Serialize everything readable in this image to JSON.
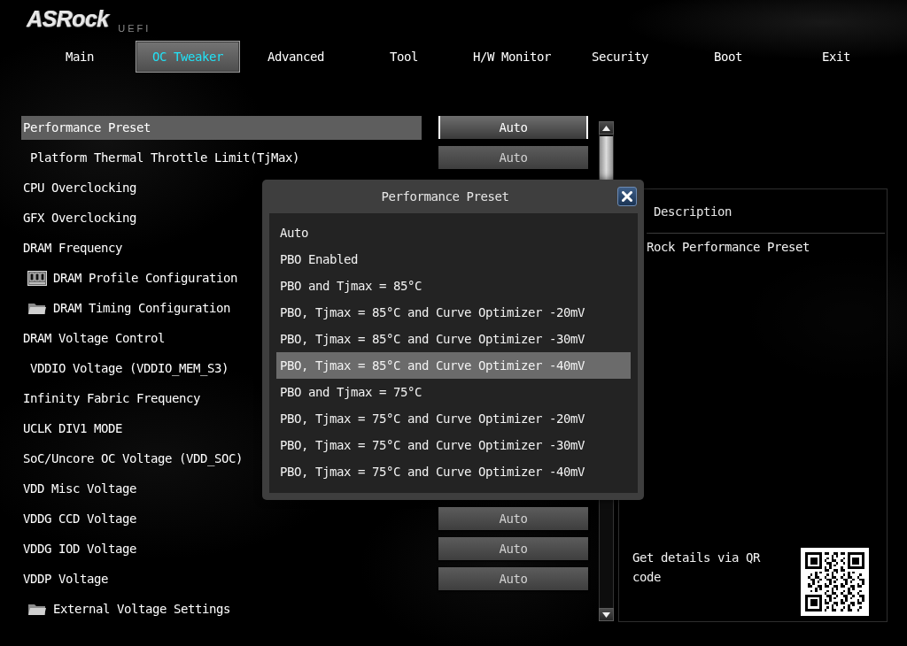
{
  "logo": {
    "brand": "ASRock",
    "suffix": "UEFI"
  },
  "tabs": [
    {
      "label": "Main",
      "selected": false
    },
    {
      "label": "OC Tweaker",
      "selected": true
    },
    {
      "label": "Advanced",
      "selected": false
    },
    {
      "label": "Tool",
      "selected": false
    },
    {
      "label": "H/W Monitor",
      "selected": false
    },
    {
      "label": "Security",
      "selected": false
    },
    {
      "label": "Boot",
      "selected": false
    },
    {
      "label": "Exit",
      "selected": false
    }
  ],
  "settings": {
    "rows": [
      {
        "kind": "item",
        "label": "Performance Preset",
        "selected": true,
        "value": "Auto"
      },
      {
        "kind": "subitem",
        "label": "Platform Thermal Throttle Limit(TjMax)",
        "selected": false,
        "value": "Auto"
      },
      {
        "kind": "item",
        "label": "CPU Overclocking",
        "selected": false
      },
      {
        "kind": "item",
        "label": "GFX Overclocking",
        "selected": false
      },
      {
        "kind": "item",
        "label": "DRAM Frequency",
        "selected": false
      },
      {
        "kind": "module",
        "label": "DRAM Profile Configuration",
        "selected": false
      },
      {
        "kind": "folder",
        "label": "DRAM Timing Configuration",
        "selected": false
      },
      {
        "kind": "item",
        "label": "DRAM Voltage Control",
        "selected": false
      },
      {
        "kind": "subitem",
        "label": "VDDIO Voltage (VDDIO_MEM_S3)",
        "selected": false
      },
      {
        "kind": "item",
        "label": "Infinity Fabric Frequency",
        "selected": false
      },
      {
        "kind": "item",
        "label": "UCLK DIV1 MODE",
        "selected": false
      },
      {
        "kind": "item",
        "label": "SoC/Uncore OC Voltage (VDD_SOC)",
        "selected": false
      },
      {
        "kind": "item",
        "label": "VDD Misc Voltage",
        "selected": false
      },
      {
        "kind": "item",
        "label": "VDDG CCD Voltage",
        "selected": false,
        "value": "Auto"
      },
      {
        "kind": "item",
        "label": "VDDG IOD Voltage",
        "selected": false,
        "value": "Auto"
      },
      {
        "kind": "item",
        "label": "VDDP Voltage",
        "selected": false,
        "value": "Auto"
      },
      {
        "kind": "folder",
        "label": "External Voltage Settings",
        "selected": false
      }
    ]
  },
  "popup": {
    "title": "Performance Preset",
    "options": [
      {
        "label": "Auto",
        "selected": false
      },
      {
        "label": "PBO Enabled",
        "selected": false
      },
      {
        "label": "PBO and Tjmax = 85°C",
        "selected": false
      },
      {
        "label": "PBO, Tjmax = 85°C and Curve Optimizer -20mV",
        "selected": false
      },
      {
        "label": "PBO, Tjmax = 85°C and Curve Optimizer -30mV",
        "selected": false
      },
      {
        "label": "PBO, Tjmax = 85°C and Curve Optimizer -40mV",
        "selected": true
      },
      {
        "label": "PBO and Tjmax = 75°C",
        "selected": false
      },
      {
        "label": "PBO, Tjmax = 75°C and Curve Optimizer -20mV",
        "selected": false
      },
      {
        "label": "PBO, Tjmax = 75°C and Curve Optimizer -30mV",
        "selected": false
      },
      {
        "label": "PBO, Tjmax = 75°C and Curve Optimizer -40mV",
        "selected": false
      }
    ]
  },
  "description": {
    "heading": "Description",
    "text": "Rock Performance Preset",
    "qr_hint": "Get details via QR code"
  }
}
